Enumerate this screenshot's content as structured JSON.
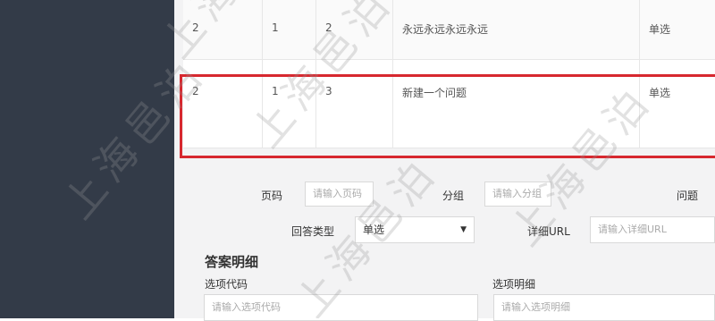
{
  "table": {
    "rows": [
      {
        "page": "2",
        "group": "1",
        "index": "2",
        "question": "永远永远永远永远",
        "type": "单选"
      },
      {
        "page": "2",
        "group": "1",
        "index": "3",
        "question": "新建一个问题",
        "type": "单选"
      }
    ]
  },
  "form": {
    "page_label": "页码",
    "page_placeholder": "请输入页码",
    "group_label": "分组",
    "group_placeholder": "请输入分组",
    "question_label": "问题",
    "answer_type_label": "回答类型",
    "answer_type_value": "单选",
    "detail_url_label": "详细URL",
    "detail_url_placeholder": "请输入详细URL"
  },
  "answer_detail": {
    "title": "答案明细",
    "option_code_label": "选项代码",
    "option_code_placeholder": "请输入选项代码",
    "option_detail_label": "选项明细",
    "option_detail_placeholder": "请输入选项明细"
  },
  "watermark": {
    "text": "上海邑泊"
  },
  "colors": {
    "sidebar": "#333b48",
    "highlight": "#d7282f",
    "background": "#f3f3f4"
  }
}
